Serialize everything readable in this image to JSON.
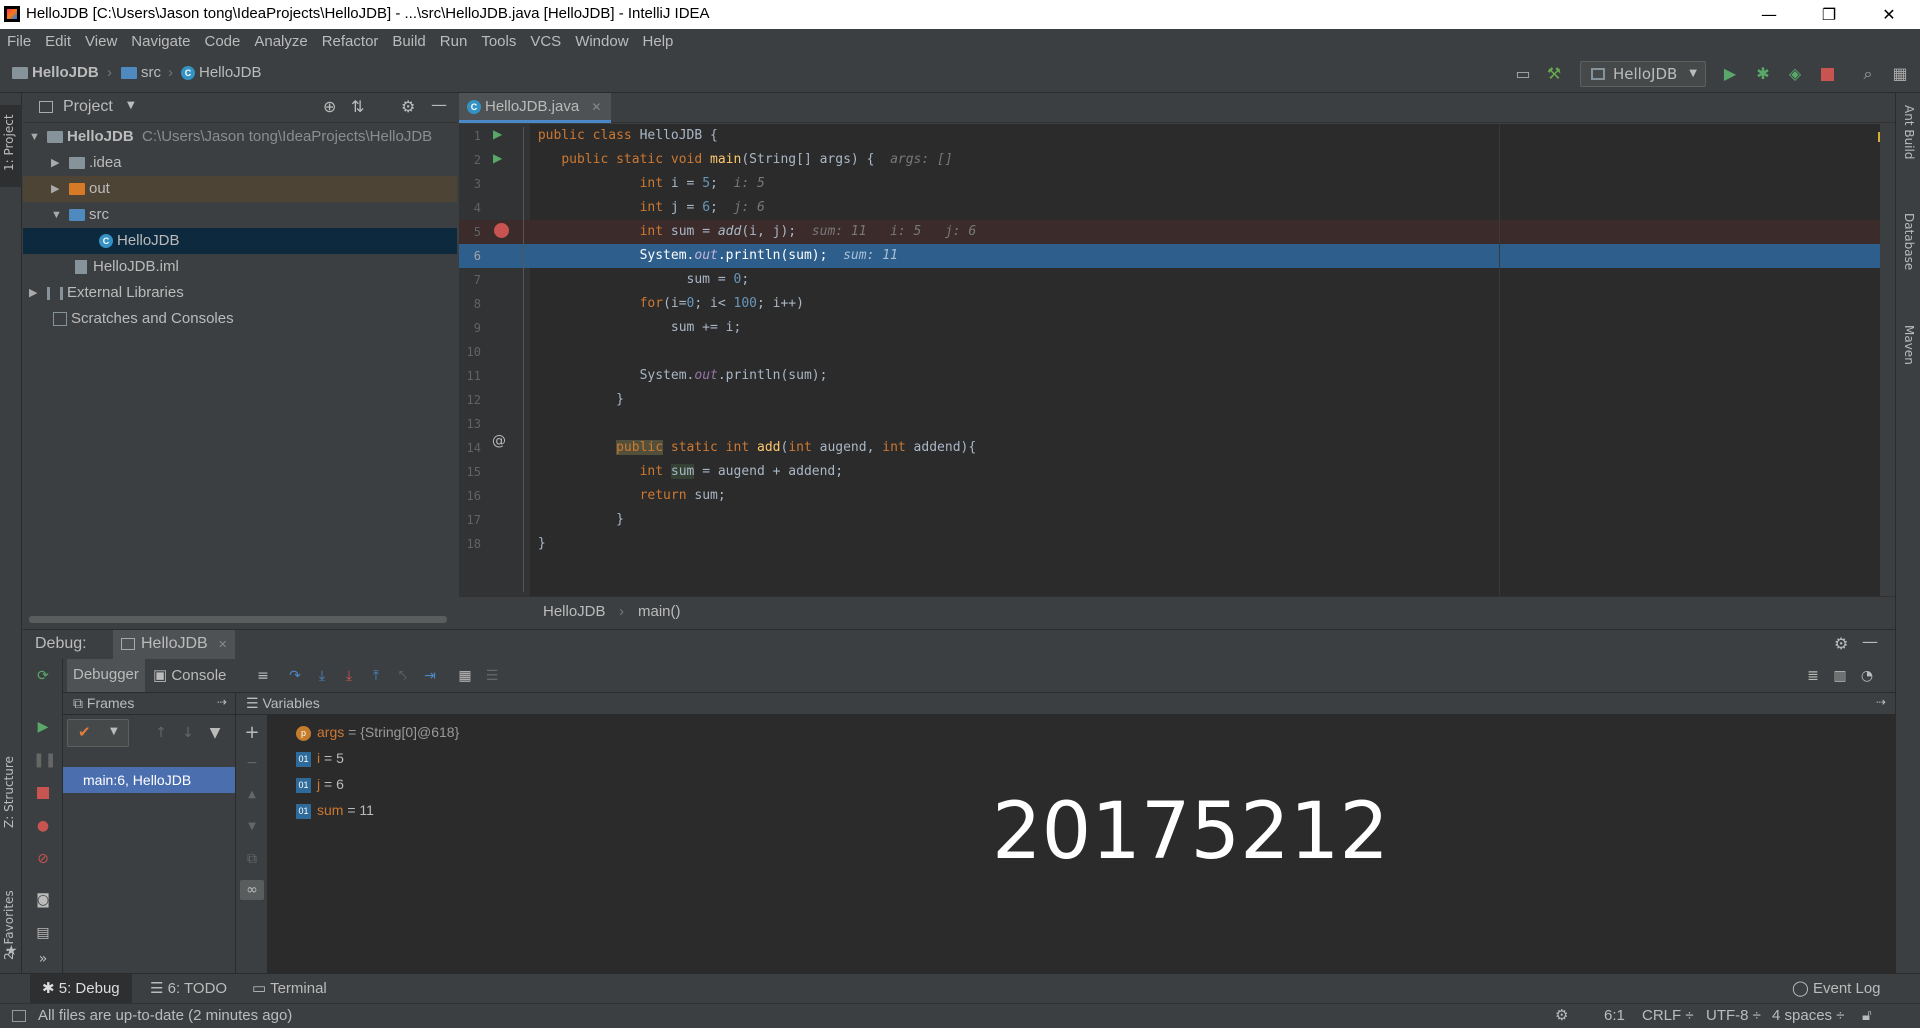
{
  "window": {
    "title": "HelloJDB [C:\\Users\\Jason tong\\IdeaProjects\\HelloJDB] - ...\\src\\HelloJDB.java [HelloJDB] - IntelliJ IDEA",
    "minimize": "—",
    "restore": "❐",
    "close": "✕"
  },
  "menu": [
    "File",
    "Edit",
    "View",
    "Navigate",
    "Code",
    "Analyze",
    "Refactor",
    "Build",
    "Run",
    "Tools",
    "VCS",
    "Window",
    "Help"
  ],
  "breadcrumb": {
    "project": "HelloJDB",
    "folder": "src",
    "file": "HelloJDB"
  },
  "toolbar": {
    "run_config": "HelloJDB"
  },
  "left_stripe": {
    "project_tab": "1: Project",
    "structure_tab": "Z: Structure",
    "favorites_tab": "2: Favorites"
  },
  "right_stripe": {
    "ant": "Ant Build",
    "database": "Database",
    "maven": "Maven"
  },
  "project_panel": {
    "title": "Project",
    "tree": [
      {
        "label": "HelloJDB",
        "path": "C:\\Users\\Jason tong\\IdeaProjects\\HelloJDB"
      },
      {
        "label": ".idea"
      },
      {
        "label": "out"
      },
      {
        "label": "src"
      },
      {
        "label": "HelloJDB"
      },
      {
        "label": "HelloJDB.iml"
      },
      {
        "label": "External Libraries"
      },
      {
        "label": "Scratches and Consoles"
      }
    ]
  },
  "editor": {
    "tab": "HelloJDB.java",
    "line_numbers": [
      "1",
      "2",
      "3",
      "4",
      "5",
      "6",
      "7",
      "8",
      "9",
      "10",
      "11",
      "12",
      "13",
      "14",
      "15",
      "16",
      "17",
      "18"
    ],
    "inline_values": {
      "args": "args: []",
      "i": "i: 5",
      "j": "j: 6",
      "sum_line": "sum: 11   i: 5   j: 6",
      "sum": "sum: 11"
    },
    "crumb": {
      "class": "HelloJDB",
      "method": "main()"
    }
  },
  "debug": {
    "label": "Debug:",
    "session": "HelloJDB",
    "tab_debugger": "Debugger",
    "tab_console": "Console",
    "frames_title": "Frames",
    "variables_title": "Variables",
    "frame": "main:6, HelloJDB",
    "variables": [
      {
        "icon": "p",
        "name": "args",
        "value": " = {String[0]@618}"
      },
      {
        "icon": "01",
        "name": "i",
        "value": " = 5"
      },
      {
        "icon": "01",
        "name": "j",
        "value": " = 6"
      },
      {
        "icon": "01",
        "name": "sum",
        "value": " = 11"
      }
    ],
    "watermark": "20175212"
  },
  "toolwindows": {
    "debug": "5: Debug",
    "todo": "6: TODO",
    "terminal": "Terminal",
    "event_log": "Event Log"
  },
  "status": {
    "message": "All files are up-to-date (2 minutes ago)",
    "position": "6:1",
    "line_sep": "CRLF ÷",
    "encoding": "UTF-8 ÷",
    "indent": "4 spaces ÷"
  }
}
